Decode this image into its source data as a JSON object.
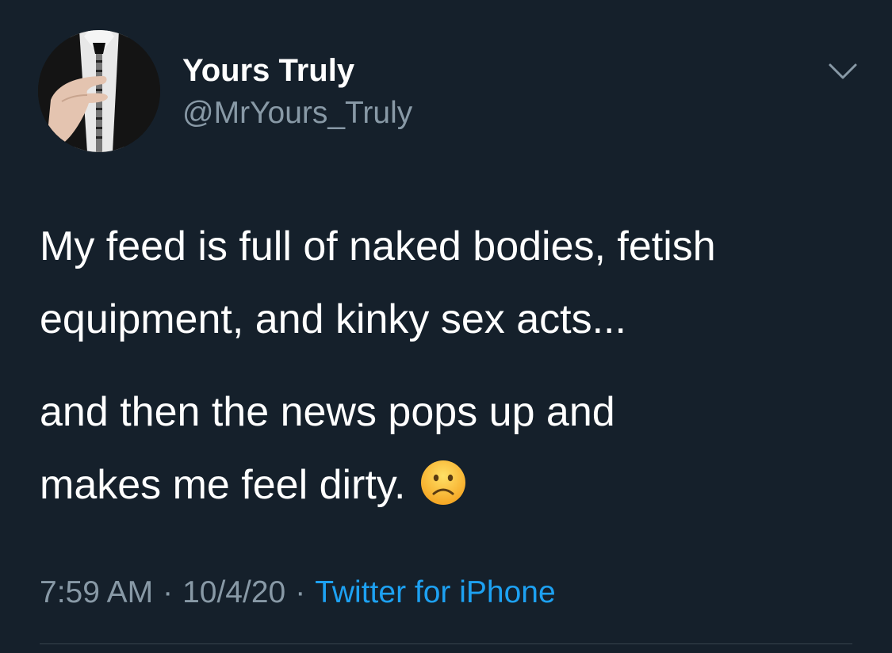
{
  "colors": {
    "background": "#15202b",
    "text_primary": "#ffffff",
    "text_secondary": "#8899a6",
    "link": "#1da1f2",
    "divider": "#38444d"
  },
  "author": {
    "display_name": "Yours Truly",
    "handle": "@MrYours_Truly",
    "avatar_icon": "profile-photo"
  },
  "menu": {
    "icon": "chevron-down-icon"
  },
  "tweet": {
    "paragraphs": [
      {
        "lines": [
          "My feed is full of naked bodies, fetish",
          "equipment, and kinky sex acts..."
        ]
      },
      {
        "lines": [
          "and then the news pops up and",
          "makes me feel dirty."
        ],
        "trailing_emoji": "frowning-face-emoji"
      }
    ]
  },
  "meta": {
    "time": "7:59 AM",
    "separator": "·",
    "date": "10/4/20",
    "source": "Twitter for iPhone"
  }
}
